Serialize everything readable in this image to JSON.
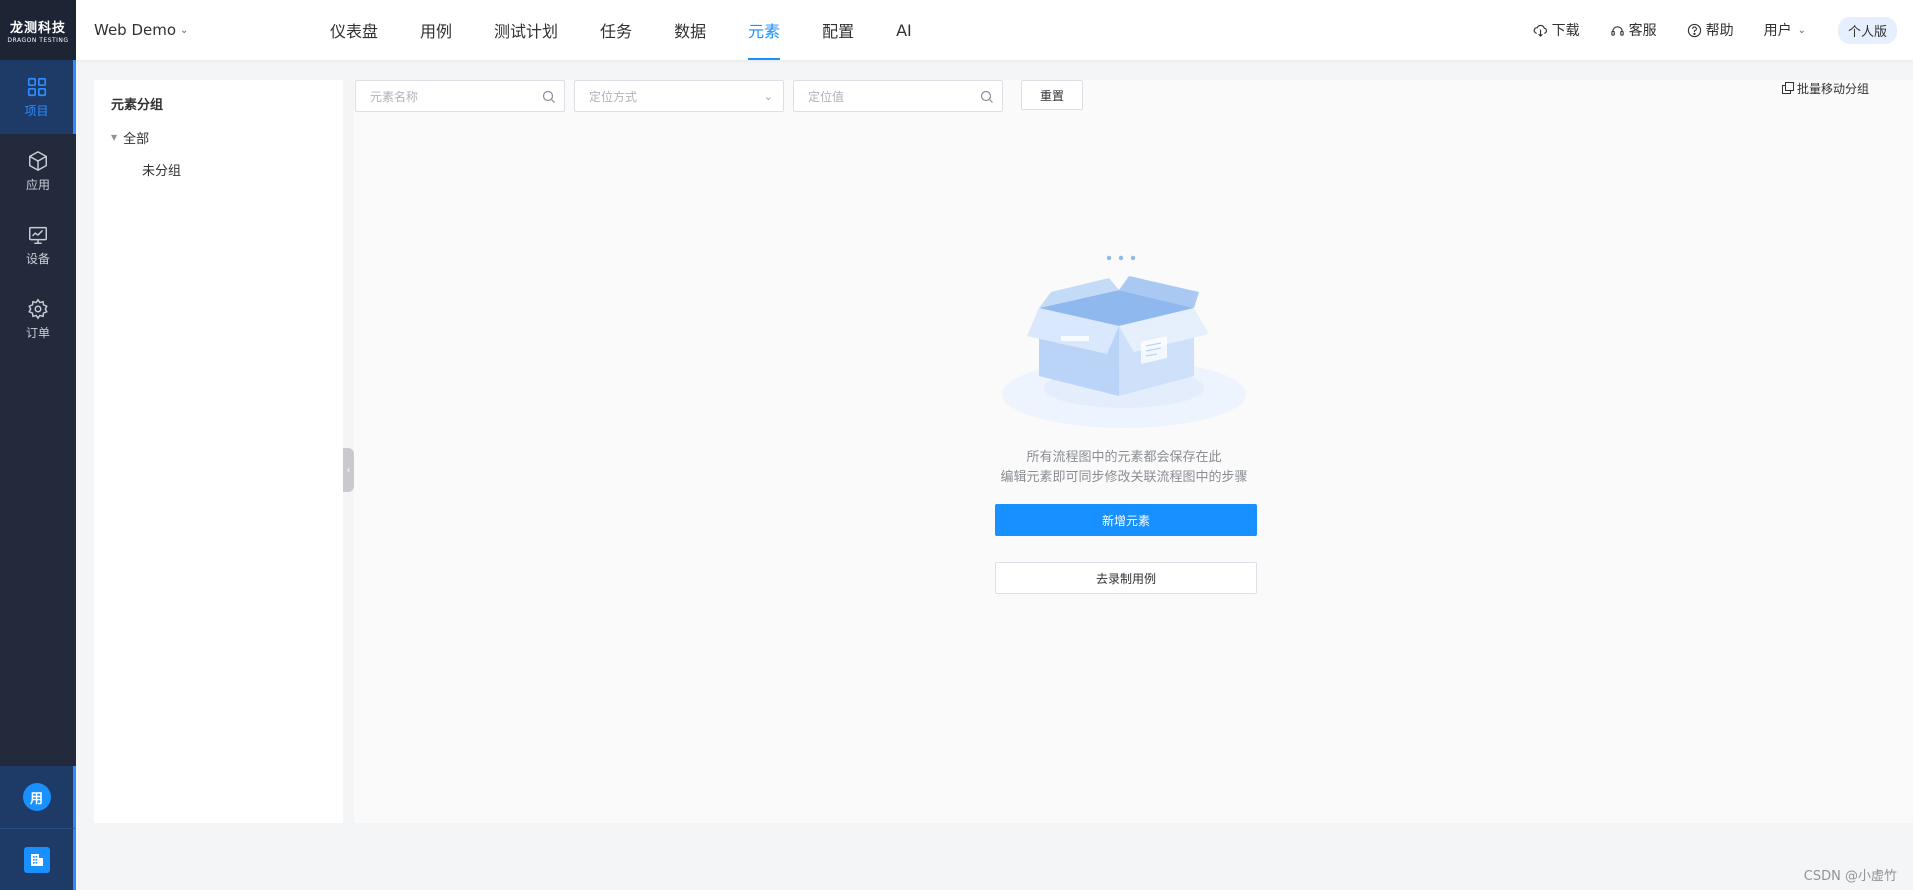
{
  "app": {
    "logo_cn": "龙测科技",
    "logo_en": "DRAGON TESTING",
    "project_name": "Web Demo"
  },
  "rail": {
    "items": [
      {
        "label": "项目",
        "icon": "grid-icon",
        "active": true
      },
      {
        "label": "应用",
        "icon": "cube-icon",
        "active": false
      },
      {
        "label": "设备",
        "icon": "monitor-icon",
        "active": false
      },
      {
        "label": "订单",
        "icon": "gear-icon",
        "active": false
      }
    ],
    "avatar_text": "用"
  },
  "nav": {
    "items": [
      "仪表盘",
      "用例",
      "测试计划",
      "任务",
      "数据",
      "元素",
      "配置",
      "AI"
    ],
    "active": "元素"
  },
  "tools": {
    "download": "下载",
    "service": "客服",
    "help": "帮助",
    "user": "用户",
    "edition": "个人版"
  },
  "groups": {
    "title": "元素分组",
    "all": "全部",
    "ungrouped": "未分组"
  },
  "filters": {
    "name_placeholder": "元素名称",
    "method_placeholder": "定位方式",
    "value_placeholder": "定位值",
    "reset": "重置",
    "batch_move": "批量移动分组"
  },
  "empty": {
    "line1": "所有流程图中的元素都会保存在此",
    "line2": "编辑元素即可同步修改关联流程图中的步骤",
    "add_button": "新增元素",
    "record_button": "去录制用例"
  },
  "colors": {
    "accent": "#1890ff",
    "rail_bg": "#232a3b",
    "rail_active_bg": "#1e3a66"
  },
  "watermark": "CSDN @小虚竹"
}
